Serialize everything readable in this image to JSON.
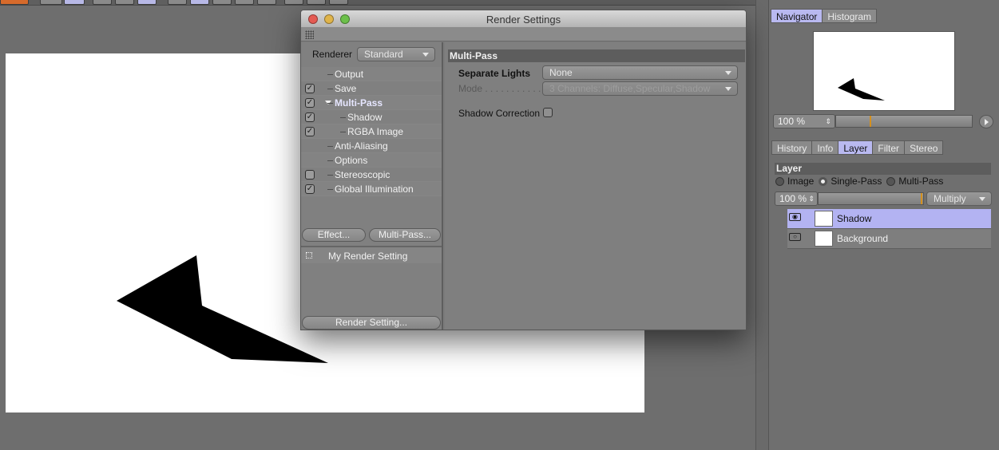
{
  "dialog": {
    "title": "Render Settings",
    "renderer_label": "Renderer",
    "renderer_value": "Standard",
    "tree": [
      {
        "label": "Output",
        "checkbox": "none",
        "level": 1
      },
      {
        "label": "Save",
        "checkbox": "checked",
        "level": 1
      },
      {
        "label": "Multi-Pass",
        "checkbox": "checked",
        "level": 1,
        "expanded": true,
        "active": true
      },
      {
        "label": "Shadow",
        "checkbox": "checked",
        "level": 2
      },
      {
        "label": "RGBA Image",
        "checkbox": "checked",
        "level": 2
      },
      {
        "label": "Anti-Aliasing",
        "checkbox": "none",
        "level": 1
      },
      {
        "label": "Options",
        "checkbox": "none",
        "level": 1
      },
      {
        "label": "Stereoscopic",
        "checkbox": "unchecked",
        "level": 1
      },
      {
        "label": "Global Illumination",
        "checkbox": "checked",
        "level": 1
      }
    ],
    "effect_button": "Effect...",
    "multipass_button": "Multi-Pass...",
    "setting_name": "My Render Setting",
    "render_setting_button": "Render Setting...",
    "section_title": "Multi-Pass",
    "separate_lights_label": "Separate Lights",
    "separate_lights_value": "None",
    "mode_label": "Mode . . . . . . . . . . . .",
    "mode_value": "3 Channels: Diffuse,Specular,Shadow",
    "shadow_correction_label": "Shadow Correction"
  },
  "picture_viewer": {
    "tabs_top": [
      "Navigator",
      "Histogram"
    ],
    "active_top_tab": "Navigator",
    "zoom": "100 %",
    "tabs_mid": [
      "History",
      "Info",
      "Layer",
      "Filter",
      "Stereo"
    ],
    "active_mid_tab": "Layer",
    "layer_section": "Layer",
    "radios": [
      {
        "label": "Image",
        "on": false
      },
      {
        "label": "Single-Pass",
        "on": true
      },
      {
        "label": "Multi-Pass",
        "on": false
      }
    ],
    "layer_opacity": "100 %",
    "blend_mode": "Multiply",
    "layers": [
      {
        "name": "Shadow",
        "selected": true
      },
      {
        "name": "Background",
        "selected": false
      }
    ]
  },
  "colors": {
    "accent_tab": "#b9b9f0",
    "selected_layer": "#b3b3f2",
    "slider_mark": "#d4901e"
  }
}
